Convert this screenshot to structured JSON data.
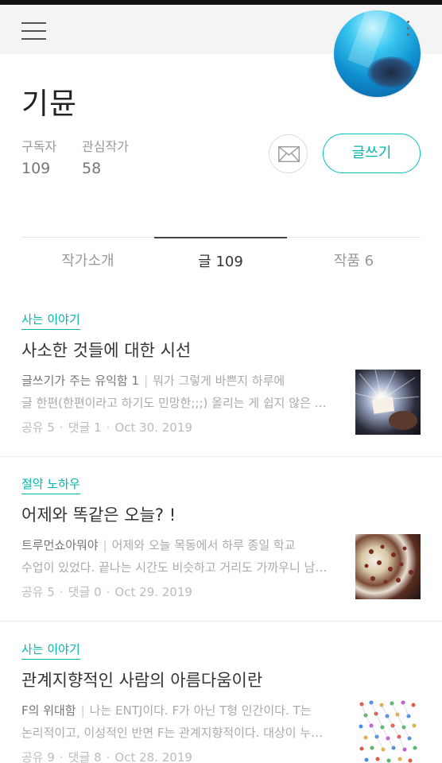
{
  "profile": {
    "name": "기뮨",
    "subscribers_label": "구독자",
    "subscribers": "109",
    "watching_label": "관심작가",
    "watching": "58",
    "write_button": "글쓰기"
  },
  "tabs": [
    {
      "label": "작가소개"
    },
    {
      "label": "글 109"
    },
    {
      "label": "작품 6"
    }
  ],
  "posts": [
    {
      "category": "사는 이야기",
      "title": "사소한 것들에 대한 시선",
      "subtitle": "글쓰기가 주는 유익함 1",
      "excerpt_1": "뭐가 그렇게 바쁜지 하루에",
      "excerpt_2": "글 한편(한편이라고 하기도 민망한;;;) 올리는 게 쉽지 않은 …",
      "meta_share": "공유 5",
      "meta_comments": "댓글 1",
      "meta_date": "Oct 30. 2019"
    },
    {
      "category": "절약 노하우",
      "title": "어제와 똑같은 오늘? !",
      "subtitle": "트루먼쇼아뭐야",
      "excerpt_1": "어제와 오늘 목동에서 하루 종일 학교",
      "excerpt_2": "수업이 있었다. 끝나는 시간도 비슷하고 거리도 가까우니 남…",
      "meta_share": "공유 5",
      "meta_comments": "댓글 0",
      "meta_date": "Oct 29. 2019"
    },
    {
      "category": "사는 이야기",
      "title": "관계지향적인 사람의 아름다움이란",
      "subtitle": "F의 위대함",
      "excerpt_1": "나는 ENTJ이다. F가 아닌 T형 인간이다. T는",
      "excerpt_2": "논리적이고, 이성적인 반면 F는 관계지향적이다. 대상이 누…",
      "meta_share": "공유 9",
      "meta_comments": "댓글 8",
      "meta_date": "Oct 28. 2019"
    }
  ],
  "colors": {
    "accent": "#00b5ae",
    "header_bg": "#f4f4f4"
  }
}
